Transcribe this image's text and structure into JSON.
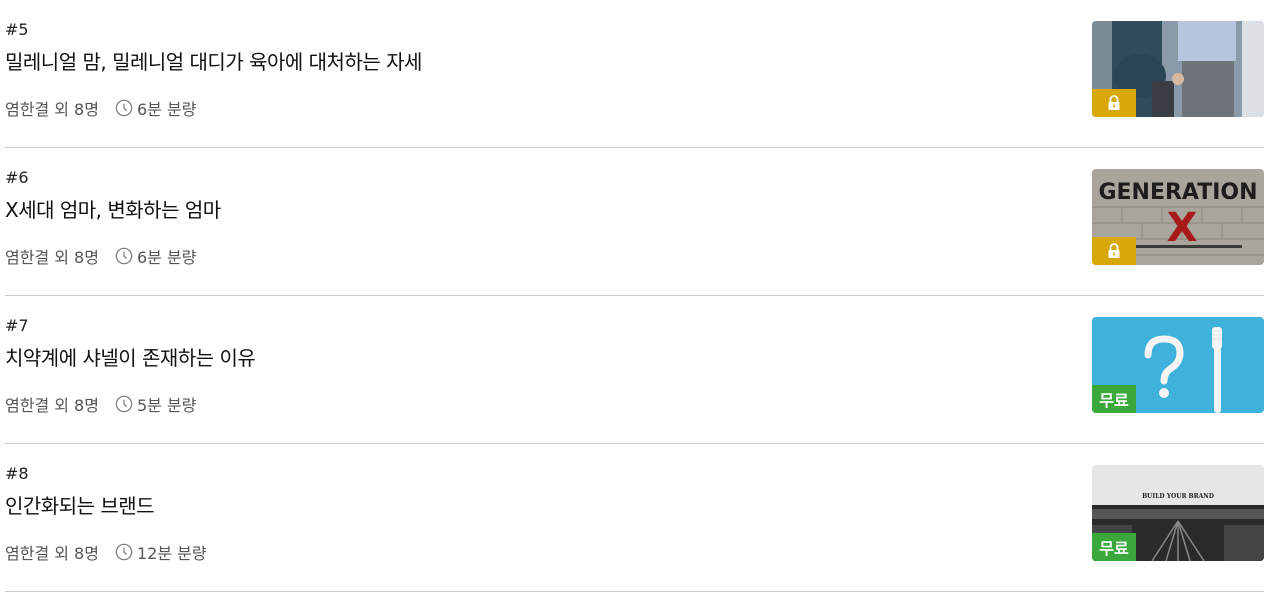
{
  "items": [
    {
      "number": "#5",
      "title": "밀레니얼 맘, 밀레니얼 대디가 육아에 대처하는 자세",
      "author": "염한결 외 8명",
      "duration": "6분 분량",
      "badge": "lock"
    },
    {
      "number": "#6",
      "title": "X세대 엄마, 변화하는 엄마",
      "author": "염한결 외 8명",
      "duration": "6분 분량",
      "badge": "lock",
      "thumb_text": "GENERATION",
      "thumb_mark": "X"
    },
    {
      "number": "#7",
      "title": "치약계에 샤넬이 존재하는 이유",
      "author": "염한결 외 8명",
      "duration": "5분 분량",
      "badge": "무료"
    },
    {
      "number": "#8",
      "title": "인간화되는 브랜드",
      "author": "염한결 외 8명",
      "duration": "12분 분량",
      "badge": "무료",
      "thumb_text": "BUILD YOUR BRAND"
    }
  ],
  "colors": {
    "lock_badge": "#d8a80a",
    "free_badge": "#3aa83a",
    "divider": "#c9c9c9"
  }
}
